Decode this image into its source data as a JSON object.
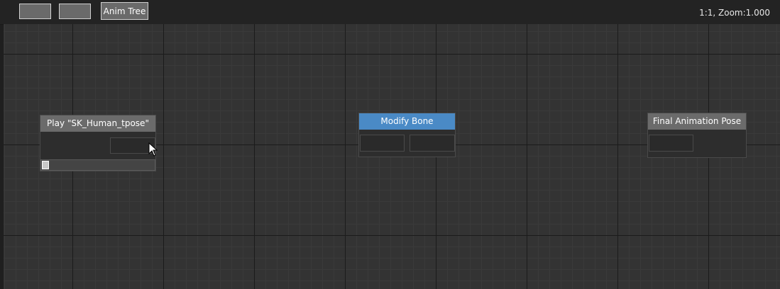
{
  "toolbar": {
    "button_1_label": "",
    "button_2_label": "",
    "anim_tree_label": "Anim Tree",
    "status": "1:1, Zoom:1.000"
  },
  "nodes": {
    "play": {
      "title": "Play \"SK_Human_tpose\"",
      "timeline_progress": 0
    },
    "modify_bone": {
      "title": "Modify Bone"
    },
    "final_pose": {
      "title": "Final Animation Pose"
    }
  },
  "colors": {
    "canvas_bg": "#333333",
    "node_header": "#6b6b6b",
    "node_header_selected": "#4a8ac6"
  },
  "icons": {
    "cursor": "mouse-pointer-icon"
  }
}
